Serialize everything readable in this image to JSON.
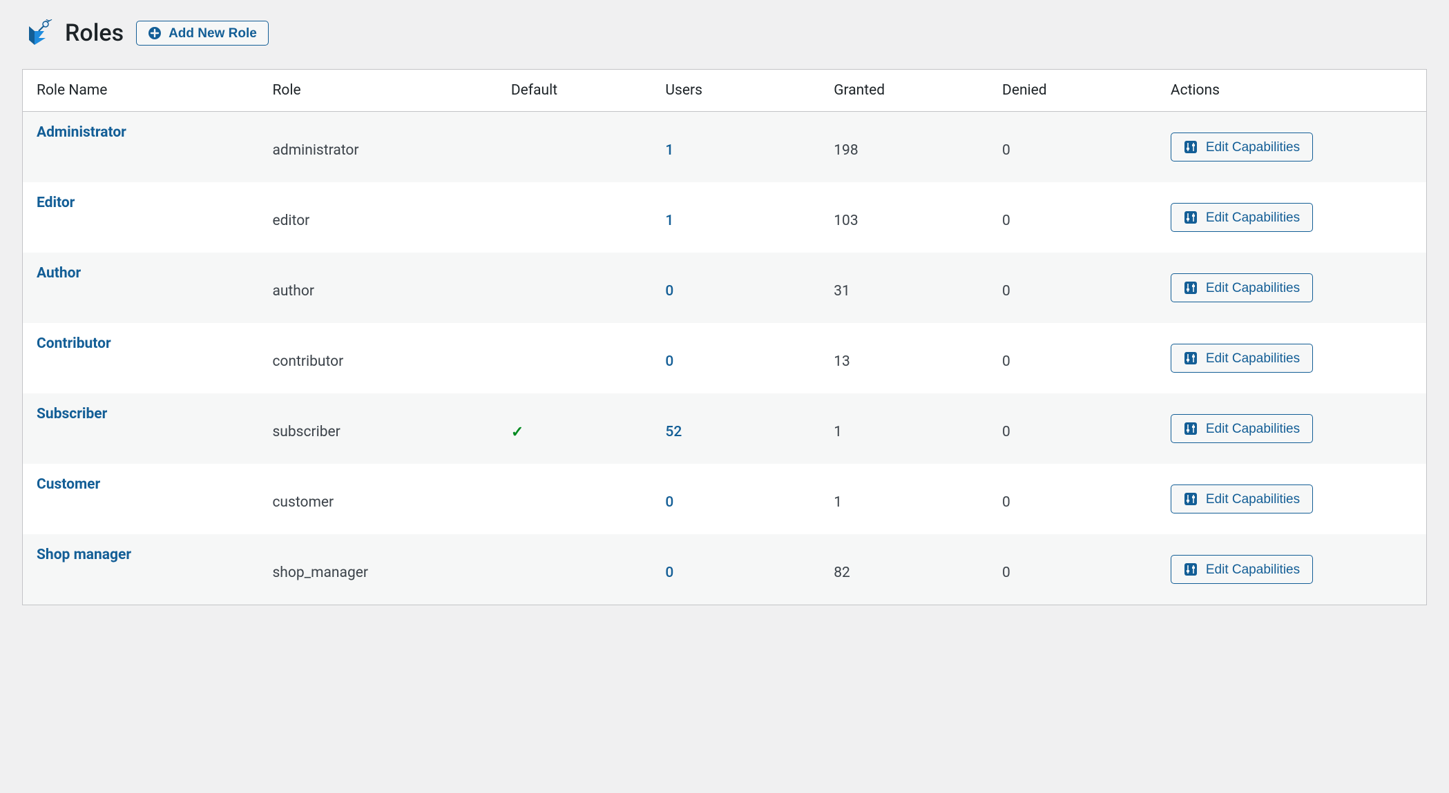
{
  "header": {
    "title": "Roles",
    "add_button_label": "Add New Role"
  },
  "columns": {
    "role_name": "Role Name",
    "role": "Role",
    "default": "Default",
    "users": "Users",
    "granted": "Granted",
    "denied": "Denied",
    "actions": "Actions"
  },
  "action_button_label": "Edit Capabilities",
  "rows": [
    {
      "role_name": "Administrator",
      "role": "administrator",
      "default": false,
      "users": "1",
      "granted": "198",
      "denied": "0"
    },
    {
      "role_name": "Editor",
      "role": "editor",
      "default": false,
      "users": "1",
      "granted": "103",
      "denied": "0"
    },
    {
      "role_name": "Author",
      "role": "author",
      "default": false,
      "users": "0",
      "granted": "31",
      "denied": "0"
    },
    {
      "role_name": "Contributor",
      "role": "contributor",
      "default": false,
      "users": "0",
      "granted": "13",
      "denied": "0"
    },
    {
      "role_name": "Subscriber",
      "role": "subscriber",
      "default": true,
      "users": "52",
      "granted": "1",
      "denied": "0"
    },
    {
      "role_name": "Customer",
      "role": "customer",
      "default": false,
      "users": "0",
      "granted": "1",
      "denied": "0"
    },
    {
      "role_name": "Shop manager",
      "role": "shop_manager",
      "default": false,
      "users": "0",
      "granted": "82",
      "denied": "0"
    }
  ]
}
